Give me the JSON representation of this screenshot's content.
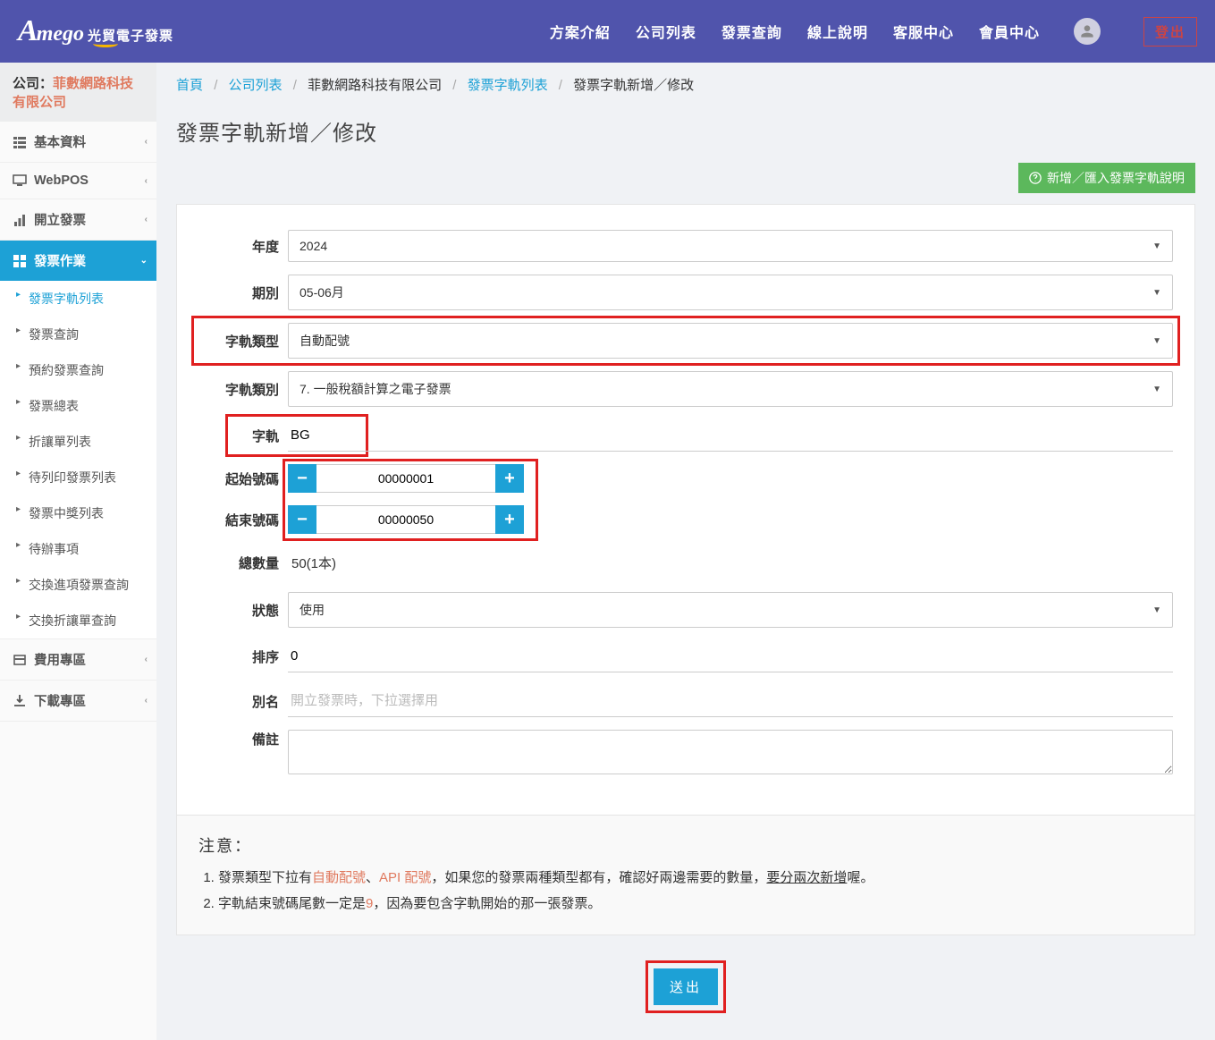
{
  "logo": {
    "brand": "Amego",
    "sub": "光貿電子發票"
  },
  "nav": {
    "plans": "方案介紹",
    "companies": "公司列表",
    "invoice_query": "發票查詢",
    "online_help": "線上說明",
    "support": "客服中心",
    "member": "會員中心",
    "logout": "登出"
  },
  "sidebar": {
    "company_prefix": "公司：",
    "company_name": "菲數網路科技有限公司",
    "items": [
      {
        "label": "基本資料"
      },
      {
        "label": "WebPOS"
      },
      {
        "label": "開立發票"
      },
      {
        "label": "發票作業"
      },
      {
        "label": "費用專區"
      },
      {
        "label": "下載專區"
      }
    ],
    "submenu": [
      {
        "label": "發票字軌列表"
      },
      {
        "label": "發票查詢"
      },
      {
        "label": "預約發票查詢"
      },
      {
        "label": "發票總表"
      },
      {
        "label": "折讓單列表"
      },
      {
        "label": "待列印發票列表"
      },
      {
        "label": "發票中獎列表"
      },
      {
        "label": "待辦事項"
      },
      {
        "label": "交換進項發票查詢"
      },
      {
        "label": "交換折讓單查詢"
      }
    ]
  },
  "breadcrumb": {
    "home": "首頁",
    "companies": "公司列表",
    "company_name": "菲數網路科技有限公司",
    "track_list": "發票字軌列表",
    "current": "發票字軌新增／修改"
  },
  "page_title": "發票字軌新增／修改",
  "help_button": "新增／匯入發票字軌說明",
  "form": {
    "year_label": "年度",
    "year_value": "2024",
    "period_label": "期別",
    "period_value": "05-06月",
    "track_type_label": "字軌類型",
    "track_type_value": "自動配號",
    "track_cat_label": "字軌類別",
    "track_cat_value": "7. 一般稅額計算之電子發票",
    "track_label": "字軌",
    "track_value": "BG",
    "start_label": "起始號碼",
    "start_value": "00000001",
    "end_label": "結束號碼",
    "end_value": "00000050",
    "total_label": "總數量",
    "total_value": "50(1本)",
    "status_label": "狀態",
    "status_value": "使用",
    "sort_label": "排序",
    "sort_value": "0",
    "alias_label": "別名",
    "alias_placeholder": "開立發票時，下拉選擇用",
    "note_label": "備註"
  },
  "notice": {
    "title": "注意：",
    "item1_a": "發票類型下拉有",
    "item1_b": "自動配號",
    "item1_c": "、",
    "item1_d": "API 配號",
    "item1_e": "，如果您的發票兩種類型都有，確認好兩邊需要的數量，",
    "item1_f": "要分兩次新增",
    "item1_g": "喔。",
    "item2_a": "字軌結束號碼尾數一定是",
    "item2_b": "9",
    "item2_c": "，因為要包含字軌開始的那一張發票。"
  },
  "submit": "送出"
}
